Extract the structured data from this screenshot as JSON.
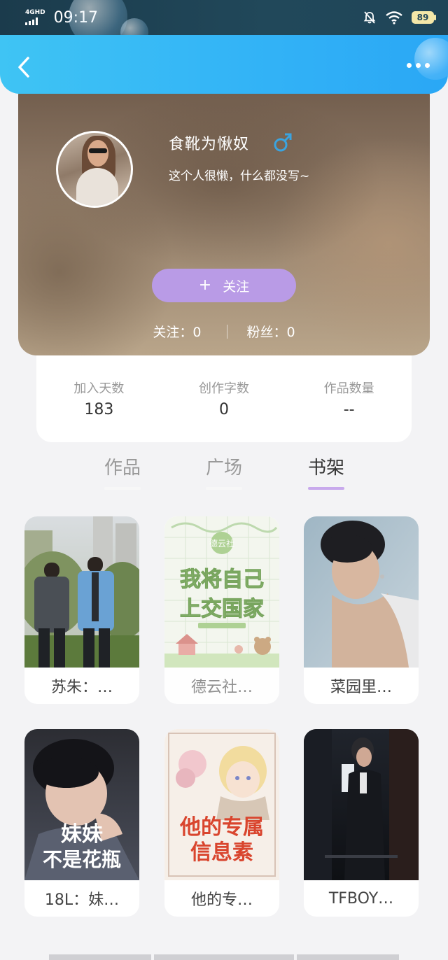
{
  "status_bar": {
    "network": "4GHD",
    "time": "09:17",
    "battery": "89"
  },
  "profile": {
    "username": "食靴为愀奴",
    "gender_symbol": "♂",
    "bio": "这个人很懒，什么都没写~",
    "follow_button_plus": "+",
    "follow_button_label": "关注",
    "following_label": "关注：",
    "following_count": "0",
    "fans_label": "粉丝：",
    "fans_count": "0"
  },
  "stats": [
    {
      "label": "加入天数",
      "value": "183"
    },
    {
      "label": "创作字数",
      "value": "0"
    },
    {
      "label": "作品数量",
      "value": "--"
    }
  ],
  "tabs": [
    {
      "label": "作品",
      "active": false
    },
    {
      "label": "广场",
      "active": false
    },
    {
      "label": "书架",
      "active": true
    }
  ],
  "books": [
    {
      "title": "苏朱：…",
      "faded": false
    },
    {
      "title": "德云社…",
      "faded": true
    },
    {
      "title": "菜园里…",
      "faded": false
    },
    {
      "title": "18L：妹…",
      "faded": false
    },
    {
      "title": "他的专…",
      "faded": false
    },
    {
      "title": "TFBOY…",
      "faded": false
    }
  ],
  "cover_text": {
    "book2_line1": "德云社",
    "book2_line2": "我将自己",
    "book2_line3": "上交国家",
    "book4_line1": "妹妹",
    "book4_line2": "不是花瓶",
    "book5_line1": "他的专属",
    "book5_line2": "信息素"
  },
  "colors": {
    "nav_bar": "#34b5f6",
    "accent": "#b99be6",
    "tab_underline": "#c8a9ec",
    "gender_icon": "#3aa4e0"
  }
}
